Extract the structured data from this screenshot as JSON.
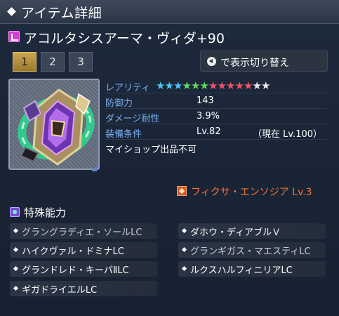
{
  "window": {
    "title": "アイテム詳細"
  },
  "item": {
    "name": "アコルタシスアーマ・ヴィダ+90"
  },
  "tabs": [
    {
      "label": "1",
      "active": true
    },
    {
      "label": "2",
      "active": false
    },
    {
      "label": "3",
      "active": false
    }
  ],
  "toggle": {
    "label": "で表示切り替え"
  },
  "stats": {
    "rarity_label": "レアリティ",
    "rarity_stars": 13,
    "rarity_star_colors": [
      "#4fc4f4",
      "#4fc4f4",
      "#4fc4f4",
      "#64d65f",
      "#64d65f",
      "#64d65f",
      "#f0526a",
      "#f0526a",
      "#f0526a",
      "#f0526a",
      "#f0526a",
      "#e8e8ee",
      "#e8e8ee"
    ],
    "defense_label": "防御力",
    "defense_value": "143",
    "damage_resist_label": "ダメージ耐性",
    "damage_resist_value": "3.9%",
    "requirement_label": "装備条件",
    "requirement_value": "Lv.82",
    "requirement_current": "（現在 Lv.100）",
    "restriction": "マイショップ出品不可"
  },
  "fixa": {
    "name": "フィクサ・エンソジア Lv.3"
  },
  "special": {
    "title": "特殊能力",
    "abilities": [
      "グラングラディエ・ソールLC",
      "ダホウ・ディアブルＶ",
      "ハイクヴァル・ドミナLC",
      "グランギガス・マエスティLC",
      "グランドレド・キーパⅡLC",
      "ルクスハルフィニリアLC",
      "ギガドライエルLC"
    ]
  },
  "colors": {
    "accent_label": "#78aef0",
    "fixa_orange": "#f7753a",
    "tab_active": "#c9a450"
  }
}
